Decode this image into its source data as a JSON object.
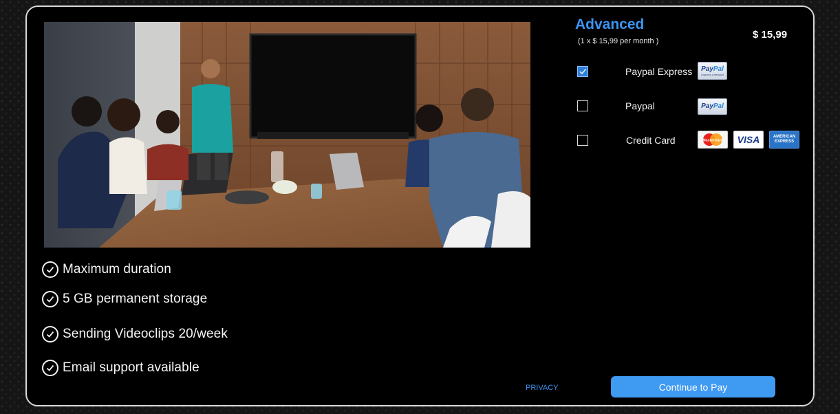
{
  "plan": {
    "title": "Advanced",
    "subtitle": "(1  x $ 15,99 per month )",
    "price": "$ 15,99"
  },
  "features": [
    {
      "label": "Maximum duration",
      "icon": "check-circle-icon"
    },
    {
      "label": "5 GB  permanent storage",
      "icon": "check-circle-icon"
    },
    {
      "label": "Sending Videoclips 20/week",
      "icon": "check-circle-icon"
    },
    {
      "label": "Email support available",
      "icon": "check-circle-icon"
    }
  ],
  "payment_options": [
    {
      "label": "Paypal Express",
      "checked": true,
      "logos": [
        "paypal-express-logo"
      ]
    },
    {
      "label": "Paypal",
      "checked": false,
      "logos": [
        "paypal-logo"
      ]
    },
    {
      "label": "Credit Card",
      "checked": false,
      "logos": [
        "mastercard-logo",
        "visa-logo",
        "american-express-logo"
      ]
    }
  ],
  "logos": {
    "paypal_text_1": "Pay",
    "paypal_text_2": "Pal",
    "paypal_express_small": "Express Checkout",
    "mastercard_text": "MasterCard",
    "visa_text": "VISA",
    "amex_line1": "AMERICAN",
    "amex_line2": "EXPRESS"
  },
  "footer": {
    "privacy": "PRIVACY",
    "continue": "Continue to Pay"
  },
  "colors": {
    "accent": "#3d94f0",
    "button": "#3f9af2",
    "background": "#000000",
    "border": "#d9d9d9"
  }
}
